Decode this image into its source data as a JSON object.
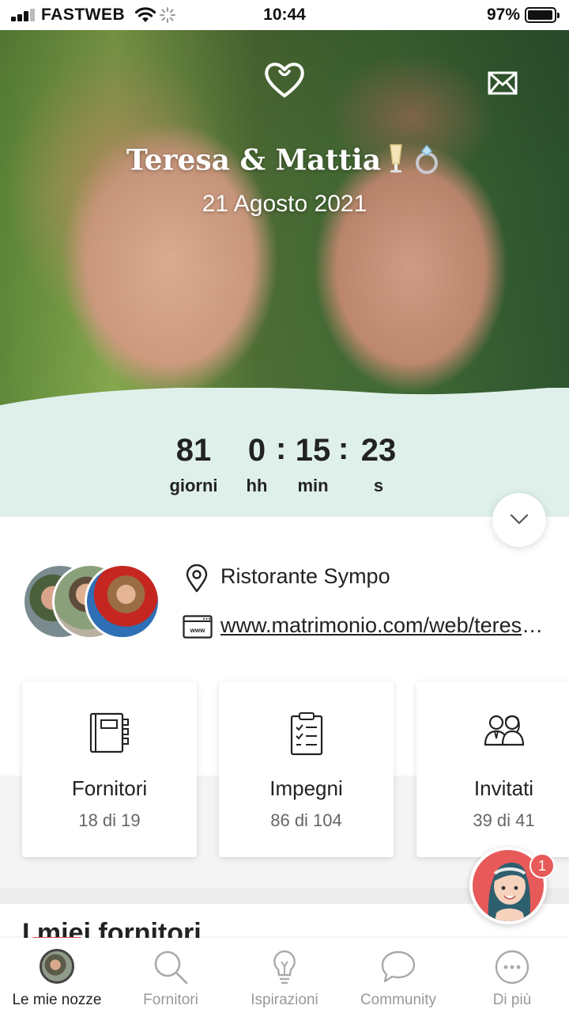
{
  "status_bar": {
    "carrier": "FASTWEB",
    "time": "10:44",
    "battery_percent": "97%",
    "battery_level": 0.97,
    "icons": [
      "signal-icon",
      "wifi-icon",
      "loading-icon",
      "battery-icon"
    ]
  },
  "hero": {
    "title": "Teresa & Mattia",
    "title_emojis": [
      "champagne-icon",
      "ring-icon"
    ],
    "date": "21 Agosto 2021",
    "icons": [
      "heart-icon",
      "mail-icon"
    ]
  },
  "countdown": {
    "days": "81",
    "days_label": "giorni",
    "hours": "0",
    "hours_label": "hh",
    "minutes": "15",
    "minutes_label": "min",
    "seconds": "23",
    "seconds_label": "s",
    "separator": ":",
    "band_color": "#dff0ea"
  },
  "info": {
    "location": "Ristorante Sympo",
    "website": "www.matrimonio.com/web/teresa-mattia"
  },
  "cards": [
    {
      "title": "Fornitori",
      "subtitle": "18 di 19",
      "icon": "notebook-icon"
    },
    {
      "title": "Impegni",
      "subtitle": "86 di 104",
      "icon": "checklist-icon"
    },
    {
      "title": "Invitati",
      "subtitle": "39 di 41",
      "icon": "guests-icon"
    }
  ],
  "section": {
    "title_peek": "I miei fornitori"
  },
  "assistant": {
    "badge": "1"
  },
  "tabbar": {
    "items": [
      {
        "label": "Le mie nozze",
        "icon": "avatar",
        "active": true
      },
      {
        "label": "Fornitori",
        "icon": "search-icon",
        "active": false
      },
      {
        "label": "Ispirazioni",
        "icon": "lightbulb-icon",
        "active": false
      },
      {
        "label": "Community",
        "icon": "chat-bubble-icon",
        "active": false
      },
      {
        "label": "Di più",
        "icon": "more-icon",
        "active": false
      }
    ]
  },
  "colors": {
    "accent": "#e85a5a",
    "band": "#dff0ea",
    "text": "#222222",
    "muted": "#999999"
  }
}
